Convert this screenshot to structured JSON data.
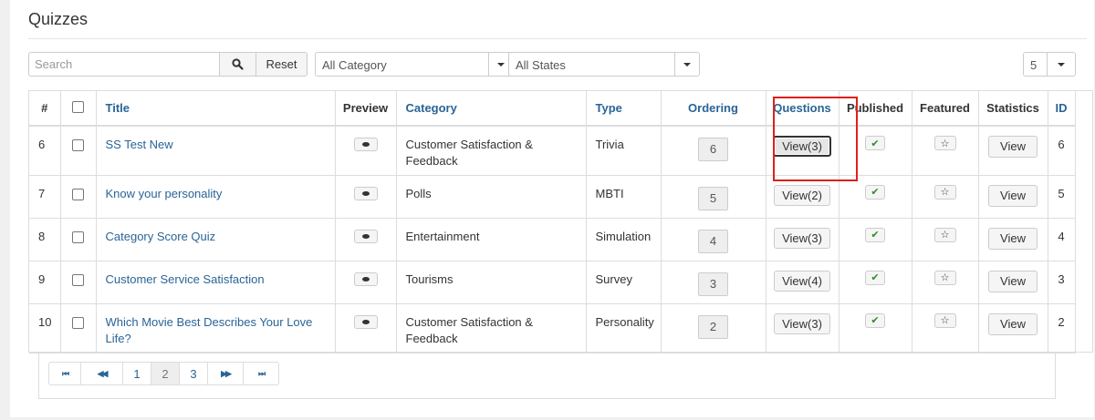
{
  "page_title": "Quizzes",
  "filters": {
    "search_placeholder": "Search",
    "search_value": "",
    "reset_label": "Reset",
    "category_select": "All Category",
    "state_select": "All States",
    "limit_select": "5"
  },
  "table": {
    "headers": {
      "num": "#",
      "title": "Title",
      "preview": "Preview",
      "category": "Category",
      "type": "Type",
      "ordering": "Ordering",
      "questions": "Questions",
      "published": "Published",
      "featured": "Featured",
      "statistics": "Statistics",
      "id": "ID"
    },
    "rows": [
      {
        "num": "6",
        "title": "SS Test New",
        "category": "Customer Satisfaction & Feedback",
        "type": "Trivia",
        "ordering": "6",
        "questions": "View(3)",
        "statistics": "View",
        "id": "6"
      },
      {
        "num": "7",
        "title": "Know your personality",
        "category": "Polls",
        "type": "MBTI",
        "ordering": "5",
        "questions": "View(2)",
        "statistics": "View",
        "id": "5"
      },
      {
        "num": "8",
        "title": "Category Score Quiz",
        "category": "Entertainment",
        "type": "Simulation",
        "ordering": "4",
        "questions": "View(3)",
        "statistics": "View",
        "id": "4"
      },
      {
        "num": "9",
        "title": "Customer Service Satisfaction",
        "category": "Tourisms",
        "type": "Survey",
        "ordering": "3",
        "questions": "View(4)",
        "statistics": "View",
        "id": "3"
      },
      {
        "num": "10",
        "title": "Which Movie Best Describes Your Love Life?",
        "category": "Customer Satisfaction & Feedback",
        "type": "Personality",
        "ordering": "2",
        "questions": "View(3)",
        "statistics": "View",
        "id": "2"
      }
    ]
  },
  "pagination": {
    "first": "⏮",
    "prev": "◀◀",
    "pages": [
      "1",
      "2",
      "3"
    ],
    "active_page": "2",
    "next": "▶▶",
    "last": "⏭"
  },
  "colors": {
    "link": "#2a6496",
    "highlight_border": "#e0201c",
    "check_green": "#2e8b2e"
  },
  "icons": {
    "search": "search-icon",
    "preview": "eye-icon",
    "published": "check-icon",
    "featured": "star-outline-icon"
  }
}
